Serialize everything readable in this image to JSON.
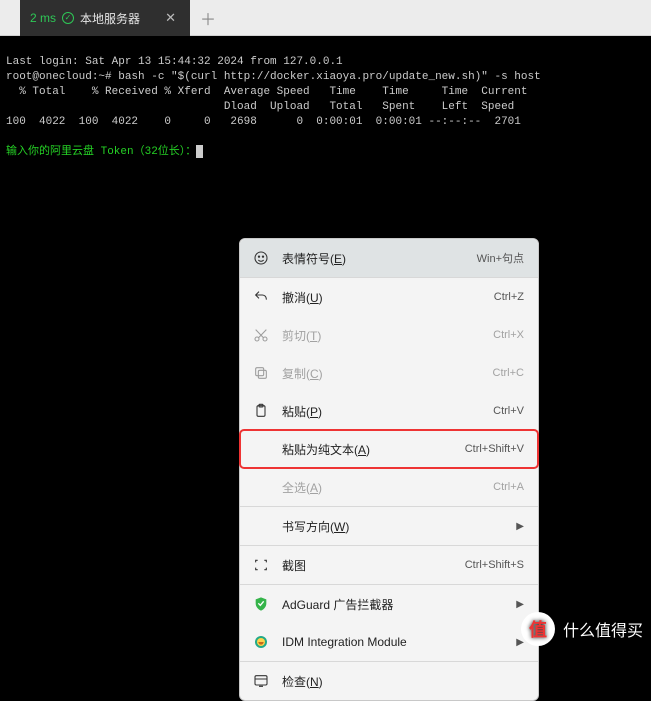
{
  "tab": {
    "latency": "2 ms",
    "title": "本地服务器"
  },
  "terminal": {
    "line1": "Last login: Sat Apr 13 15:44:32 2024 from 127.0.0.1",
    "line2": "root@onecloud:~# bash -c \"$(curl http://docker.xiaoya.pro/update_new.sh)\" -s host",
    "line3": "  % Total    % Received % Xferd  Average Speed   Time    Time     Time  Current",
    "line4": "                                 Dload  Upload   Total   Spent    Left  Speed",
    "line5": "100  4022  100  4022    0     0   2698      0  0:00:01  0:00:01 --:--:--  2701",
    "prompt": "输入你的阿里云盘 Token（32位长）："
  },
  "menu": {
    "emoji": {
      "label": "表情符号(",
      "hot": "E",
      "tail": ")",
      "shortcut": "Win+句点"
    },
    "undo": {
      "label": "撤消(",
      "hot": "U",
      "tail": ")",
      "shortcut": "Ctrl+Z"
    },
    "cut": {
      "label": "剪切(",
      "hot": "T",
      "tail": ")",
      "shortcut": "Ctrl+X"
    },
    "copy": {
      "label": "复制(",
      "hot": "C",
      "tail": ")",
      "shortcut": "Ctrl+C"
    },
    "paste": {
      "label": "粘贴(",
      "hot": "P",
      "tail": ")",
      "shortcut": "Ctrl+V"
    },
    "paste_plain": {
      "label": "粘贴为纯文本(",
      "hot": "A",
      "tail": ")",
      "shortcut": "Ctrl+Shift+V"
    },
    "select_all": {
      "label": "全选(",
      "hot": "A",
      "tail": ")",
      "shortcut": "Ctrl+A"
    },
    "writing_dir": {
      "label": "书写方向(",
      "hot": "W",
      "tail": ")"
    },
    "screenshot": {
      "label": "截图",
      "shortcut": "Ctrl+Shift+S"
    },
    "adguard": {
      "label": "AdGuard 广告拦截器"
    },
    "idm": {
      "label": "IDM Integration Module"
    },
    "inspect": {
      "label": "检查(",
      "hot": "N",
      "tail": ")"
    }
  },
  "watermark": {
    "badge": "值",
    "text": "什么值得买"
  }
}
